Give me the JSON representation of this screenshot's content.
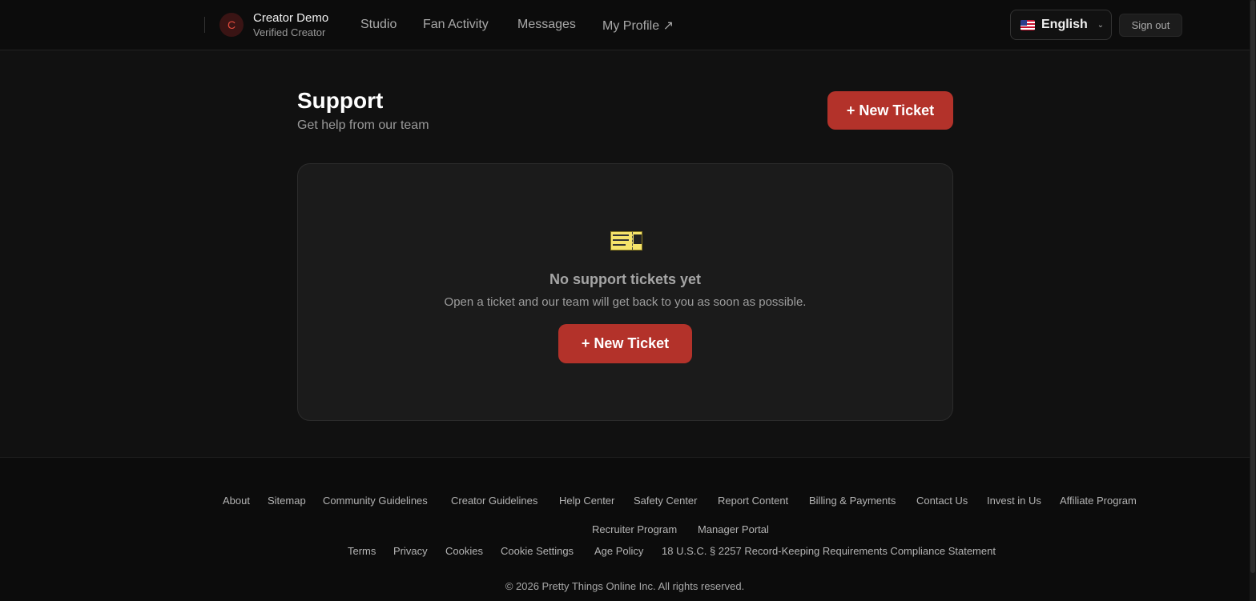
{
  "header": {
    "avatar_initial": "C",
    "user_name": "Creator Demo",
    "user_role": "Verified Creator",
    "nav": [
      "Studio",
      "Fan Activity",
      "Messages",
      "My Profile ↗"
    ],
    "language": "English",
    "sign_out": "Sign out"
  },
  "main": {
    "title": "Support",
    "subtitle": "Get help from our team",
    "new_ticket": "+ New Ticket",
    "empty_title": "No support tickets yet",
    "empty_desc": "Open a ticket and our team will get back to you as soon as possible.",
    "empty_button": "+ New Ticket"
  },
  "footer": {
    "row1": [
      "About",
      "Sitemap",
      "Community Guidelines",
      "Creator Guidelines",
      "Help Center",
      "Safety Center",
      "Report Content",
      "Billing & Payments",
      "Contact Us",
      "Invest in Us",
      "Affiliate Program"
    ],
    "row2": [
      "Recruiter Program",
      "Manager Portal"
    ],
    "row3": [
      "Terms",
      "Privacy",
      "Cookies",
      "Cookie Settings",
      "Age Policy",
      "18 U.S.C. § 2257 Record-Keeping Requirements Compliance Statement"
    ],
    "copyright": "© 2026 Pretty Things Online Inc. All rights reserved."
  },
  "colors": {
    "accent": "#b3322a",
    "background": "#111111"
  }
}
